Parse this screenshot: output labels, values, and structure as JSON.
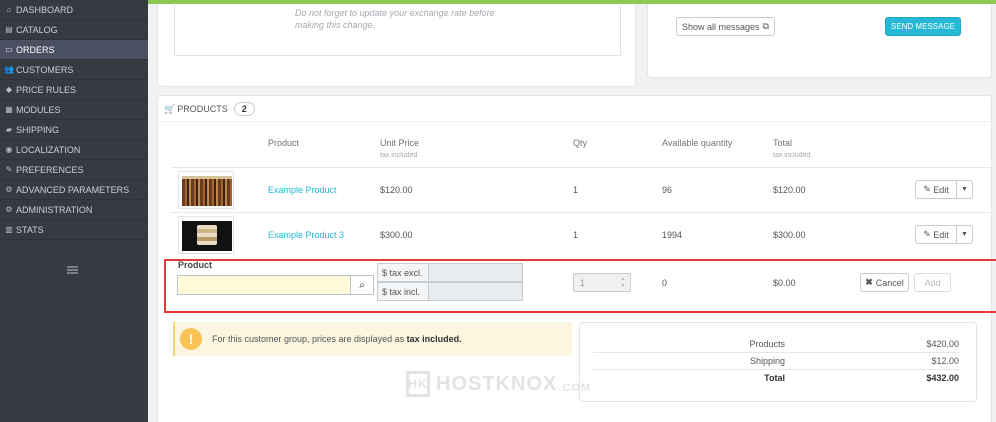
{
  "sidebar": {
    "items": [
      {
        "label": "DASHBOARD",
        "icon": "dashboard-icon",
        "glyph": "⌂"
      },
      {
        "label": "CATALOG",
        "icon": "catalog-icon",
        "glyph": "▤"
      },
      {
        "label": "ORDERS",
        "icon": "orders-icon",
        "glyph": "▭",
        "active": true
      },
      {
        "label": "CUSTOMERS",
        "icon": "customers-icon",
        "glyph": "👥"
      },
      {
        "label": "PRICE RULES",
        "icon": "price-rules-icon",
        "glyph": "◆"
      },
      {
        "label": "MODULES",
        "icon": "modules-icon",
        "glyph": "▦"
      },
      {
        "label": "SHIPPING",
        "icon": "shipping-icon",
        "glyph": "▰"
      },
      {
        "label": "LOCALIZATION",
        "icon": "localization-icon",
        "glyph": "◉"
      },
      {
        "label": "PREFERENCES",
        "icon": "preferences-icon",
        "glyph": "✎"
      },
      {
        "label": "ADVANCED PARAMETERS",
        "icon": "advanced-parameters-icon",
        "glyph": "⚙"
      },
      {
        "label": "ADMINISTRATION",
        "icon": "administration-icon",
        "glyph": "⚙"
      },
      {
        "label": "STATS",
        "icon": "stats-icon",
        "glyph": "▥"
      }
    ]
  },
  "exchange_note": "Do not forget to update your exchange rate before making this change.",
  "messages": {
    "show_all_label": "Show all messages",
    "send_label": "SEND MESSAGE"
  },
  "products_panel": {
    "title": "PRODUCTS",
    "count": "2",
    "headers": {
      "product": "Product",
      "unit_price": "Unit Price",
      "unit_price_sub": "tax included.",
      "qty": "Qty",
      "available": "Available quantity",
      "total": "Total",
      "total_sub": "tax included."
    },
    "rows": [
      {
        "name": "Example Product",
        "unit_price": "$120.00",
        "qty": "1",
        "available": "96",
        "total": "$120.00",
        "edit_label": "Edit"
      },
      {
        "name": "Example Product 3",
        "unit_price": "$300.00",
        "qty": "1",
        "available": "1994",
        "total": "$300.00",
        "edit_label": "Edit"
      }
    ],
    "add_row": {
      "product_label": "Product",
      "search_value": "",
      "tax_excl_label": "$ tax excl.",
      "tax_incl_label": "$ tax incl.",
      "qty_value": "1",
      "available": "0",
      "total": "$0.00",
      "cancel_label": "Cancel",
      "add_label": "Add"
    }
  },
  "alert": {
    "text": "For this customer group, prices are displayed as",
    "emphasis": "tax included."
  },
  "totals": {
    "rows": [
      {
        "label": "Products",
        "value": "$420.00"
      },
      {
        "label": "Shipping",
        "value": "$12.00"
      },
      {
        "label": "Total",
        "value": "$432.00"
      }
    ]
  },
  "watermark": {
    "mark": "HK",
    "name": "HOSTKNOX",
    "domain": ".COM"
  },
  "colors": {
    "sidebar_bg": "#363a41",
    "accent": "#25b9d7",
    "top_bar": "#8bc954",
    "highlight_border": "#e03a3a"
  }
}
